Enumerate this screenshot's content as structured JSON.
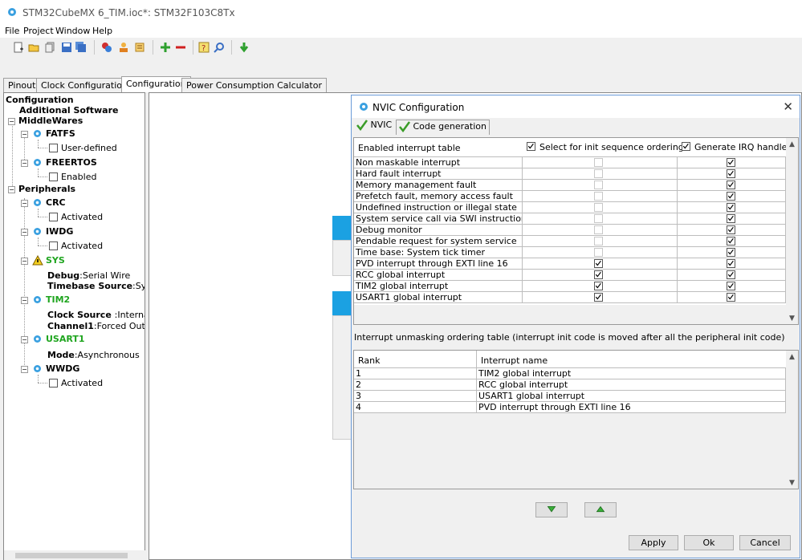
{
  "window": {
    "title": "STM32CubeMX 6_TIM.ioc*: STM32F103C8Tx"
  },
  "menu": [
    "File",
    "Project",
    "Window",
    "Help"
  ],
  "tabs": [
    "Pinout",
    "Clock Configuration",
    "Configuration",
    "Power Consumption Calculator"
  ],
  "tree": {
    "root": "Configuration",
    "additional": "Additional Software",
    "middlewares": "MiddleWares",
    "fatfs": "FATFS",
    "fatfs_opt": "User-defined",
    "freertos": "FREERTOS",
    "freertos_opt": "Enabled",
    "peripherals": "Peripherals",
    "crc": "CRC",
    "crc_opt": "Activated",
    "iwdg": "IWDG",
    "iwdg_opt": "Activated",
    "sys": "SYS",
    "sys_debug_k": "Debug",
    "sys_debug_v": ":Serial Wire",
    "sys_tb_k": "Timebase Source",
    "sys_tb_v": ":Sys",
    "tim2": "TIM2",
    "tim2_cs_k": "Clock Source ",
    "tim2_cs_v": ":Internal",
    "tim2_ch_k": "Channel1",
    "tim2_ch_v": ":Forced Outpu",
    "usart1": "USART1",
    "usart1_mode_k": "Mode",
    "usart1_mode_v": ":Asynchronous",
    "wwdg": "WWDG",
    "wwdg_opt": "Activated"
  },
  "dialog": {
    "title": "NVIC Configuration",
    "close": "✕",
    "tab_nvic": "NVIC",
    "tab_codegen": "Code generation",
    "table1": {
      "col1": "Enabled interrupt table",
      "col2": "Select for init sequence ordering",
      "col3": "Generate IRQ handler",
      "rows": [
        {
          "name": "Non maskable interrupt",
          "init": false,
          "init_enabled": false,
          "irq": true
        },
        {
          "name": "Hard fault interrupt",
          "init": false,
          "init_enabled": false,
          "irq": true
        },
        {
          "name": "Memory management fault",
          "init": false,
          "init_enabled": false,
          "irq": true
        },
        {
          "name": "Prefetch fault, memory access fault",
          "init": false,
          "init_enabled": false,
          "irq": true
        },
        {
          "name": "Undefined instruction or illegal state",
          "init": false,
          "init_enabled": false,
          "irq": true
        },
        {
          "name": "System service call via SWI instruction",
          "init": false,
          "init_enabled": false,
          "irq": true
        },
        {
          "name": "Debug monitor",
          "init": false,
          "init_enabled": false,
          "irq": true
        },
        {
          "name": "Pendable request for system service",
          "init": false,
          "init_enabled": false,
          "irq": true
        },
        {
          "name": "Time base: System tick timer",
          "init": false,
          "init_enabled": false,
          "irq": true
        },
        {
          "name": "PVD interrupt through EXTI line 16",
          "init": true,
          "init_enabled": true,
          "irq": true
        },
        {
          "name": "RCC global interrupt",
          "init": true,
          "init_enabled": true,
          "irq": true
        },
        {
          "name": "TIM2 global interrupt",
          "init": true,
          "init_enabled": true,
          "irq": true
        },
        {
          "name": "USART1 global interrupt",
          "init": true,
          "init_enabled": true,
          "irq": true
        }
      ]
    },
    "unmask_label": "Interrupt unmasking ordering table (interrupt init code is moved after all the peripheral init code)",
    "table2": {
      "col1": "Rank",
      "col2": "Interrupt name",
      "rows": [
        {
          "rank": "1",
          "name": "TIM2 global interrupt"
        },
        {
          "rank": "2",
          "name": "RCC global interrupt"
        },
        {
          "rank": "3",
          "name": "USART1 global interrupt"
        },
        {
          "rank": "4",
          "name": "PVD interrupt through EXTI line 16"
        }
      ]
    },
    "buttons": {
      "apply": "Apply",
      "ok": "Ok",
      "cancel": "Cancel"
    }
  },
  "colors": {
    "accent": "#1ba1e2",
    "green": "#1fa51f",
    "check_green": "#3a9c28"
  }
}
